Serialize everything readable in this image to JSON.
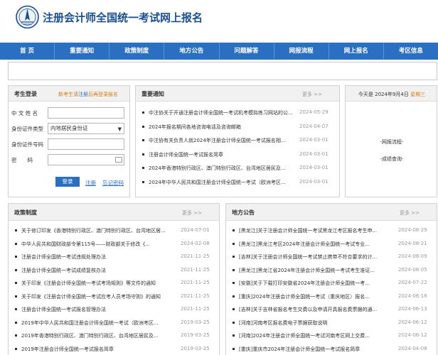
{
  "header": {
    "title": "注册会计师全国统一考试网上报名"
  },
  "nav": [
    "首 页",
    "重要通知",
    "政策制度",
    "地方公告",
    "问题解答",
    "网报流程",
    "网上报名",
    "考区信息"
  ],
  "login": {
    "title": "考生登录",
    "hint_prefix": "新考生请",
    "hint_link": "注册",
    "hint_suffix": "后再登录报名",
    "name_label": "中 文 姓 名",
    "id_type_label": "身份证件类型",
    "id_type_value": "内地居民身份证",
    "id_number_label": "身份证件号码",
    "password_label": "密　　码",
    "login_button": "登录",
    "register_link": "注册",
    "forgot_link": "忘记密码"
  },
  "notice": {
    "title": "重要通知",
    "more": "更多 >>",
    "items": [
      {
        "title": "中注协关于开通注册会计师全国统一考试机考模拟练习网站的公...",
        "date": "2024-05-29"
      },
      {
        "title": "2024年报名期间各地咨询电话及咨询邮箱",
        "date": "2024-04-07"
      },
      {
        "title": "中注协有关负责人就2024年注册会计师全国统一考试报名相...",
        "date": "2024-03-01"
      },
      {
        "title": "注册会计师全国统一考试报名简章",
        "date": "2024-03-01"
      },
      {
        "title": "2024年香港特别行政区、澳门特别行政区、台湾地区居民及...",
        "date": "2024-03-01"
      },
      {
        "title": "2024年中华人民共和国注册会计师全国统一考试（欧洲考区...",
        "date": "2024-03-01"
      }
    ]
  },
  "today": {
    "prefix": "今天是 2024年9月4日",
    "weekday": "星期三",
    "links": [
      "-网报流程-",
      "-成绩查询-"
    ]
  },
  "policy": {
    "title": "政策制度",
    "more": "更多 >>",
    "items": [
      {
        "title": "关于修订印发《香港特别行政区、澳门特别行政区、台湾地区居...",
        "date": "2024-07-01"
      },
      {
        "title": "中华人民共和国财政部令第115号——财政部关于修改《...",
        "date": "2024-02-08"
      },
      {
        "title": "注册会计师全国统一考试违规处理办法",
        "date": "2021-11-25"
      },
      {
        "title": "注册会计师全国统一考试成绩复核办法",
        "date": "2021-11-25"
      },
      {
        "title": "关于印发《注册会计师全国统一考试考场规则》等文件的通知",
        "date": "2021-11-25"
      },
      {
        "title": "关于印发《注册会计师全国统一考试应考人员考场守则》的通知",
        "date": "2021-11-25"
      },
      {
        "title": "注册会计师全国统一考试报名管理办法",
        "date": "2021-11-25"
      },
      {
        "title": "2019年中华人民共和国注册会计师全国统一考试（欧洲考区...",
        "date": "2019-03-25"
      },
      {
        "title": "2019年香港特别行政区、澳门特别行政区、台湾地区居民及...",
        "date": "2019-03-25"
      },
      {
        "title": "2019年注册会计师全国统一考试报名简章",
        "date": "2019-03-25"
      }
    ]
  },
  "local": {
    "title": "地方公告",
    "more": "更多 >>",
    "items": [
      {
        "title": "[黑龙江]关于注册会计师全国统一考试黑龙江考区报名考生申...",
        "date": "2024-08-29"
      },
      {
        "title": "[黑龙江]黑龙江考区2024年注册会计师全国统一考试专业...",
        "date": "2024-08-21"
      },
      {
        "title": "[吉林]关于注册会计师全国统一考试禁止携带不符合要求的计...",
        "date": "2024-08-09"
      },
      {
        "title": "[黑龙江]黑龙江省2024年注册会计师全国统一考试考生准证...",
        "date": "2024-08-05"
      },
      {
        "title": "[安徽]关于下载打印安徽省2024年注册会计师全国统一考...",
        "date": "2024-07-22"
      },
      {
        "title": "[重庆]2024年注册会计师全国统一考试（重庆地区）报名...",
        "date": "2024-06-18"
      },
      {
        "title": "[吉林]关于吉林省报名考生交费以及申请开具报名费票据的通...",
        "date": "2024-06-13"
      },
      {
        "title": "[河南]河南考区报名费电子票据获取说明",
        "date": "2024-06-12"
      },
      {
        "title": "[河南]2024年注册会计师全国统一考试河南考区网上交费...",
        "date": "2024-06-12"
      },
      {
        "title": "[重庆]重庆市2024年注册会计师全国统一考试报名简章",
        "date": "2024-04-08"
      }
    ]
  }
}
